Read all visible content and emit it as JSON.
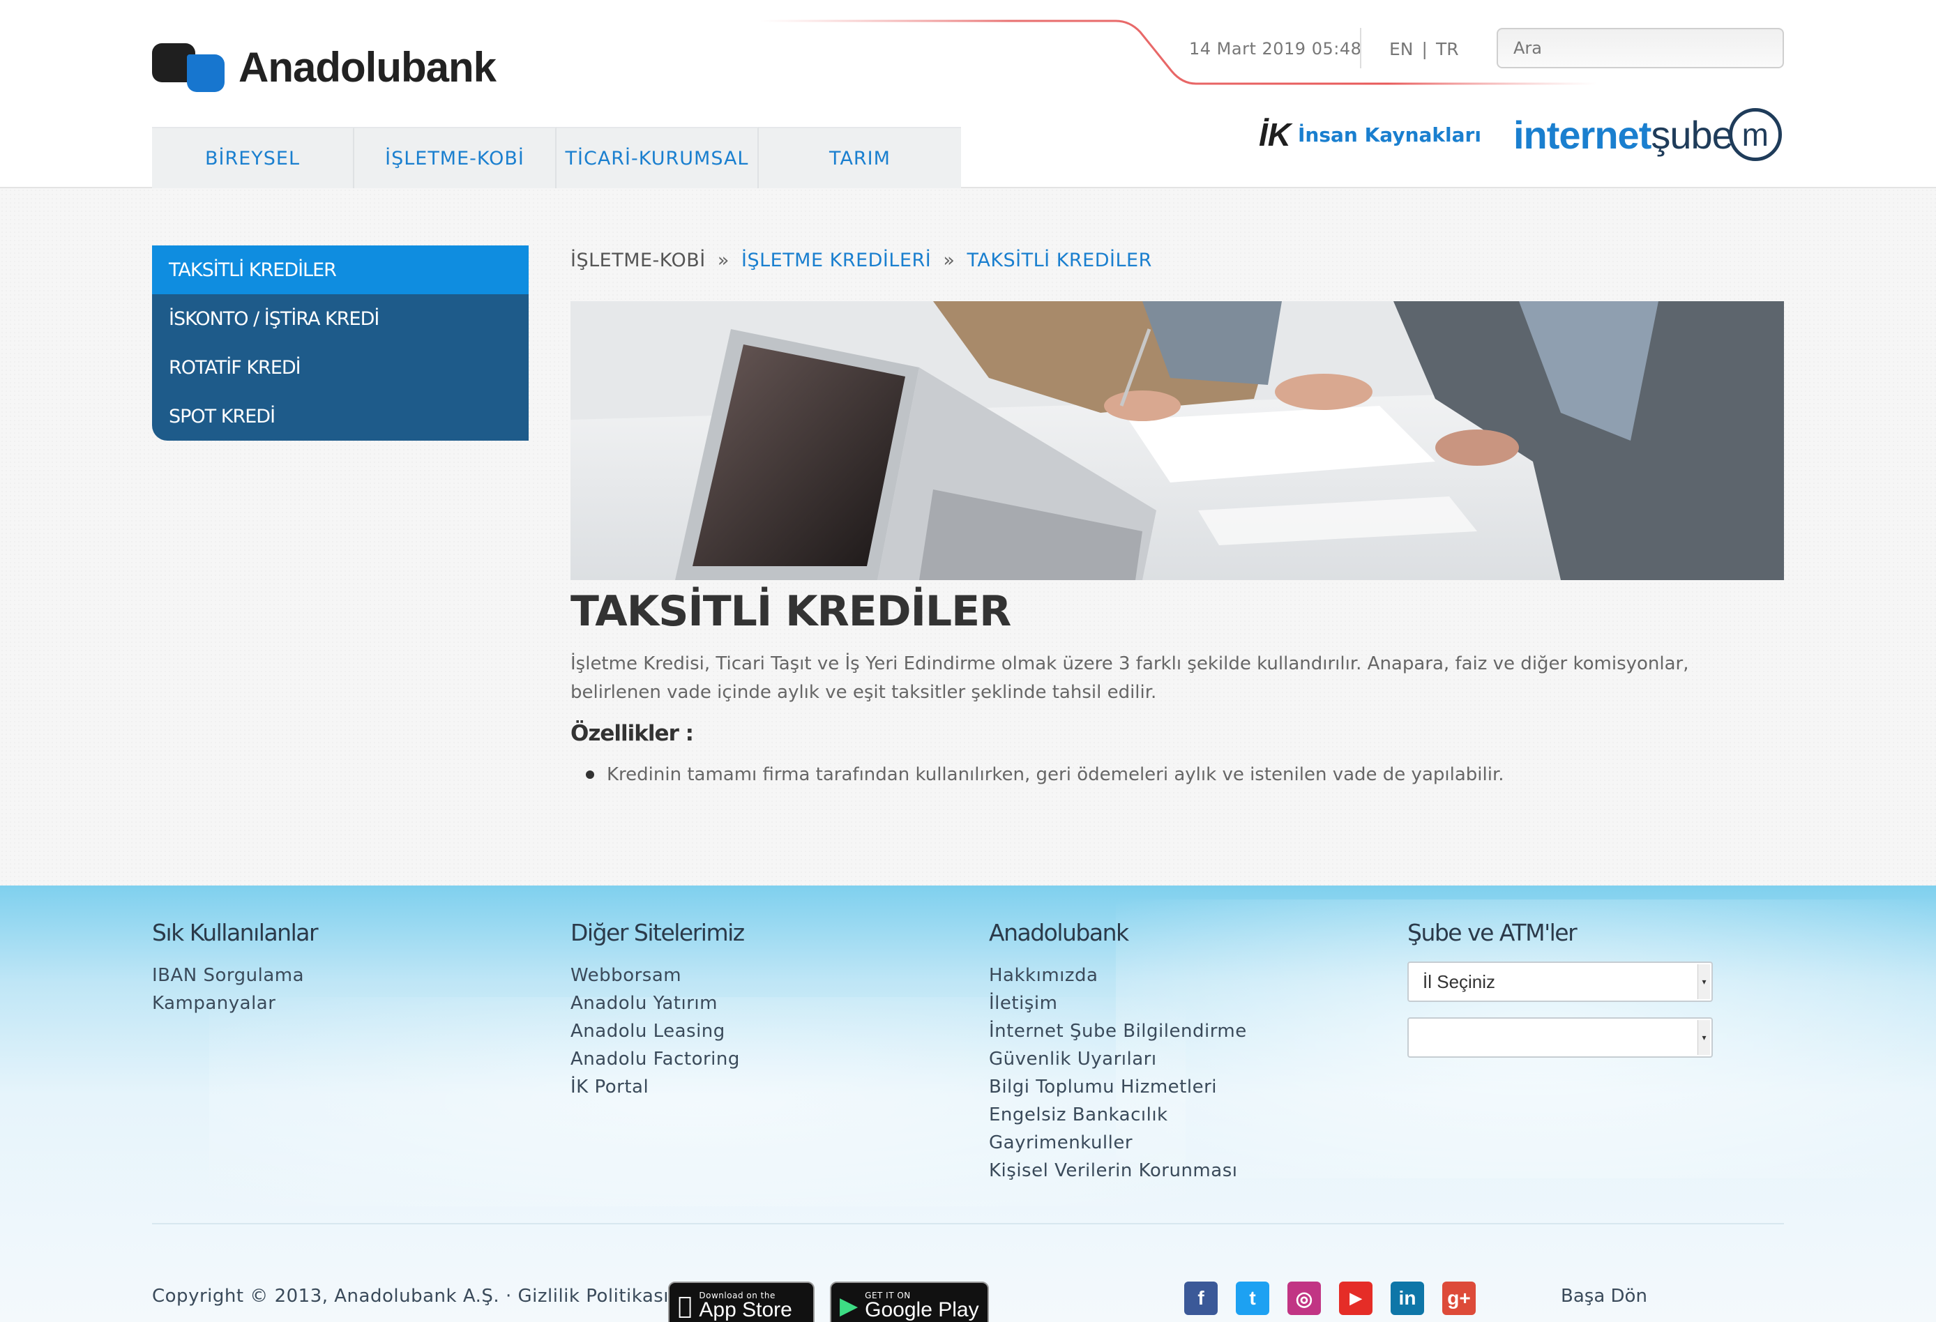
{
  "header": {
    "brand": "Anadolubank",
    "date": "14 Mart 2019 05:48",
    "lang": [
      "EN",
      "|",
      "TR"
    ],
    "search_placeholder": "Ara",
    "nav": [
      "BİREYSEL",
      "İŞLETME-KOBİ",
      "TİCARİ-KURUMSAL",
      "TARIM"
    ],
    "ik_mark": "İK",
    "ik_label": "İnsan Kaynakları",
    "internet_sube_a": "internet",
    "internet_sube_b": "şube",
    "internet_sube_m": "m"
  },
  "sidebar": {
    "items": [
      {
        "label": "TAKSİTLİ KREDİLER",
        "active": true
      },
      {
        "label": "İSKONTO / İŞTİRA KREDİ",
        "active": false
      },
      {
        "label": "ROTATİF KREDİ",
        "active": false
      },
      {
        "label": "SPOT KREDİ",
        "active": false
      }
    ]
  },
  "breadcrumb": {
    "items": [
      "İŞLETME-KOBİ",
      "»",
      "İŞLETME KREDİLERİ",
      "»",
      "TAKSİTLİ KREDİLER"
    ]
  },
  "main": {
    "title": "TAKSİTLİ KREDİLER",
    "intro": "İşletme Kredisi, Ticari Taşıt ve İş Yeri Edindirme olmak üzere 3 farklı şekilde kullandırılır. Anapara, faiz ve diğer komisyonlar, belirlenen vade içinde aylık ve eşit taksitler şeklinde tahsil edilir.",
    "features_heading": "Özellikler :",
    "features": [
      "Kredinin tamamı firma tarafından kullanılırken, geri ödemeleri aylık ve istenilen vade de yapılabilir."
    ]
  },
  "footer": {
    "col1": {
      "title": "Sık Kullanılanlar",
      "links": [
        "IBAN Sorgulama",
        "Kampanyalar"
      ]
    },
    "col2": {
      "title": "Diğer Sitelerimiz",
      "links": [
        "Webborsam",
        "Anadolu Yatırım",
        "Anadolu Leasing",
        "Anadolu Factoring",
        "İK Portal"
      ]
    },
    "col3": {
      "title": "Anadolubank",
      "links": [
        "Hakkımızda",
        "İletişim",
        "İnternet Şube Bilgilendirme",
        "Güvenlik Uyarıları",
        "Bilgi Toplumu Hizmetleri",
        "Engelsiz Bankacılık",
        "Gayrimenkuller",
        "Kişisel Verilerin Korunması"
      ]
    },
    "col4": {
      "title": "Şube ve ATM'ler",
      "select_city": "İl Seçiniz",
      "select_second": ""
    },
    "copyright": "Copyright © 2013, Anadolubank A.Ş. · Gizlilik Politikası ·",
    "appstore_small": "Download on the",
    "appstore_big": "App Store",
    "googleplay_small": "GET IT ON",
    "googleplay_big": "Google Play",
    "social": [
      {
        "icon": "facebook-icon",
        "glyph": "f",
        "color": "#3b5998"
      },
      {
        "icon": "twitter-icon",
        "glyph": "t",
        "color": "#1da1f2"
      },
      {
        "icon": "instagram-icon",
        "glyph": "◎",
        "color": "#c13584"
      },
      {
        "icon": "youtube-icon",
        "glyph": "▶",
        "color": "#e52d27"
      },
      {
        "icon": "linkedin-icon",
        "glyph": "in",
        "color": "#0e76a8"
      },
      {
        "icon": "google-plus-icon",
        "glyph": "g+",
        "color": "#dd4b39"
      }
    ],
    "back_to_top": "Başa Dön"
  },
  "colors": {
    "accent": "#1a7fcf",
    "sidebar": "#1e5b8a",
    "sidebar_active": "#0f8de0"
  }
}
